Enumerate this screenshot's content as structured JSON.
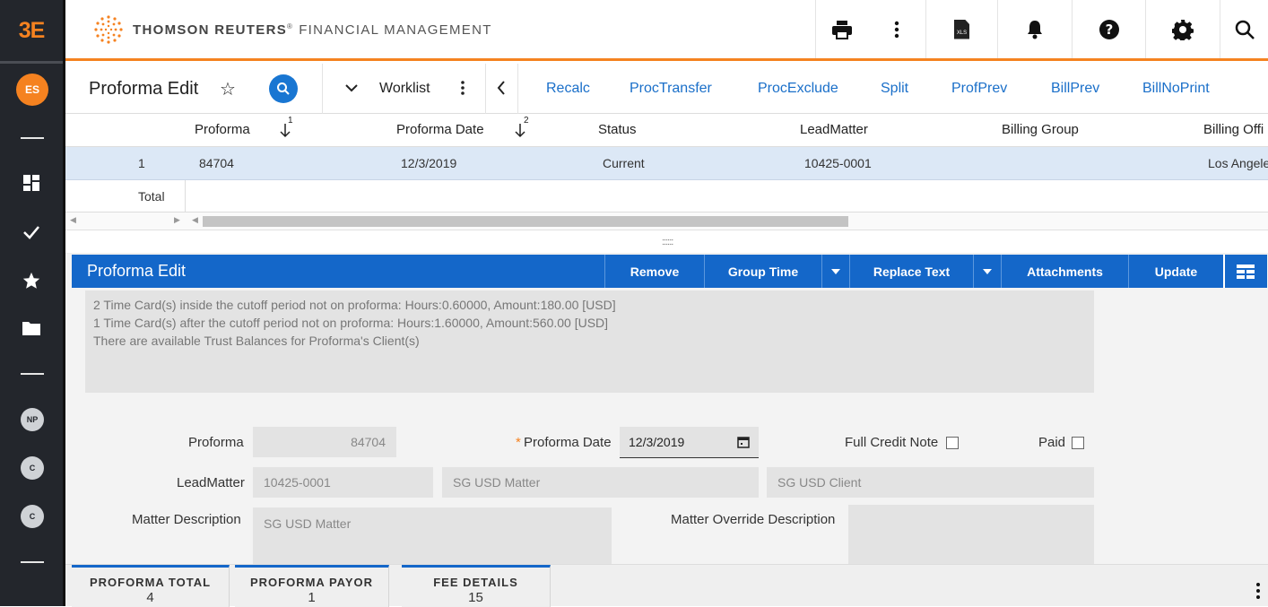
{
  "app": {
    "logo": "3E",
    "brand_name": "THOMSON REUTERS",
    "brand_product": "FINANCIAL MANAGEMENT",
    "accent_color": "#f58220",
    "primary_color": "#1467c9"
  },
  "leftnav": {
    "user_initials": "ES",
    "items": [
      {
        "icon": "dashboard-icon"
      },
      {
        "icon": "checkmark-icon"
      },
      {
        "icon": "star-icon"
      },
      {
        "icon": "folder-icon"
      }
    ],
    "recent": [
      "NP",
      "C",
      "C"
    ]
  },
  "topbar": {
    "icons": [
      "print-icon",
      "more-vertical-icon",
      "xls-export-icon",
      "bell-icon",
      "help-icon",
      "gear-icon",
      "search-icon"
    ],
    "xls_label": "XLS"
  },
  "header": {
    "title": "Proforma Edit",
    "worklist_label": "Worklist",
    "actions": [
      "Recalc",
      "ProcTransfer",
      "ProcExclude",
      "Split",
      "ProfPrev",
      "BillPrev",
      "BillNoPrint"
    ]
  },
  "grid": {
    "columns": [
      "Proforma",
      "Proforma Date",
      "Status",
      "LeadMatter",
      "Billing Group",
      "Billing Offi"
    ],
    "sort_indices": [
      "1",
      "2"
    ],
    "rows": [
      {
        "index": "1",
        "proforma": "84704",
        "date": "12/3/2019",
        "status": "Current",
        "lead_matter": "10425-0001",
        "billing_group": "",
        "billing_office": "Los Angele"
      }
    ],
    "total_label": "Total",
    "splitter_handle": "::::::"
  },
  "panel": {
    "title": "Proforma Edit",
    "buttons": {
      "remove": "Remove",
      "group_time": "Group Time",
      "replace_text": "Replace Text",
      "attachments": "Attachments",
      "update": "Update"
    },
    "messages": [
      "2 Time Card(s) inside the cutoff period not on proforma: Hours:0.60000, Amount:180.00 [USD]",
      "1 Time Card(s) after the cutoff period not on proforma: Hours:1.60000, Amount:560.00 [USD]",
      "There are available Trust Balances for Proforma's Client(s)"
    ],
    "form": {
      "proforma_label": "Proforma",
      "proforma_value": "84704",
      "date_required_mark": "*",
      "date_label": "Proforma Date",
      "date_value": "12/3/2019",
      "full_credit_label": "Full Credit Note",
      "full_credit_checked": false,
      "paid_label": "Paid",
      "paid_checked": false,
      "lead_matter_label": "LeadMatter",
      "lead_matter_value": "10425-0001",
      "matter_name": "SG USD Matter",
      "client_name": "SG USD Client",
      "matter_desc_label": "Matter Description",
      "matter_desc_value": "SG USD Matter",
      "matter_override_label": "Matter Override Description",
      "matter_override_value": ""
    }
  },
  "bottom_tabs": [
    {
      "label": "PROFORMA TOTAL",
      "value": "4"
    },
    {
      "label": "PROFORMA PAYOR",
      "value": "1"
    },
    {
      "label": "FEE DETAILS",
      "value": "15"
    }
  ]
}
